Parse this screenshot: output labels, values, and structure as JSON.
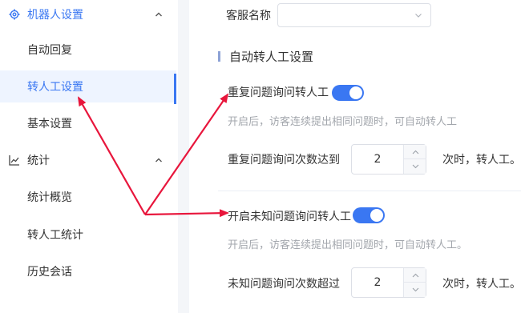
{
  "sidebar": {
    "group_robot": {
      "label": "机器人设置",
      "icon": "gear-icon"
    },
    "robot_items": [
      {
        "label": "自动回复"
      },
      {
        "label": "转人工设置"
      },
      {
        "label": "基本设置"
      }
    ],
    "group_stats": {
      "label": "统计",
      "icon": "line-chart-icon"
    },
    "stats_items": [
      {
        "label": "统计概览"
      },
      {
        "label": "转人工统计"
      },
      {
        "label": "历史会话"
      }
    ],
    "active_index": 1
  },
  "main": {
    "agent_name_label": "客服名称",
    "agent_name_value": "",
    "section_title": "自动转人工设置",
    "repeat": {
      "toggle_label": "重复问题询问转人工",
      "enabled": true,
      "hint": "开启后，访客连续提出相同问题时，可自动转人工",
      "count_label": "重复问题询问次数达到",
      "count_value": "2",
      "suffix": "次时，转人工。"
    },
    "unknown": {
      "toggle_label": "开启未知问题询问转人工",
      "enabled": true,
      "hint": "开启后，访客连续提出相同问题时，可自动转人工。",
      "count_label": "未知问题询问次数超过",
      "count_value": "2",
      "suffix": "次时，转人工。"
    }
  },
  "colors": {
    "accent": "#3a77f2",
    "annotation_arrow": "#e8163c",
    "hint_text": "#a3a7ad"
  }
}
